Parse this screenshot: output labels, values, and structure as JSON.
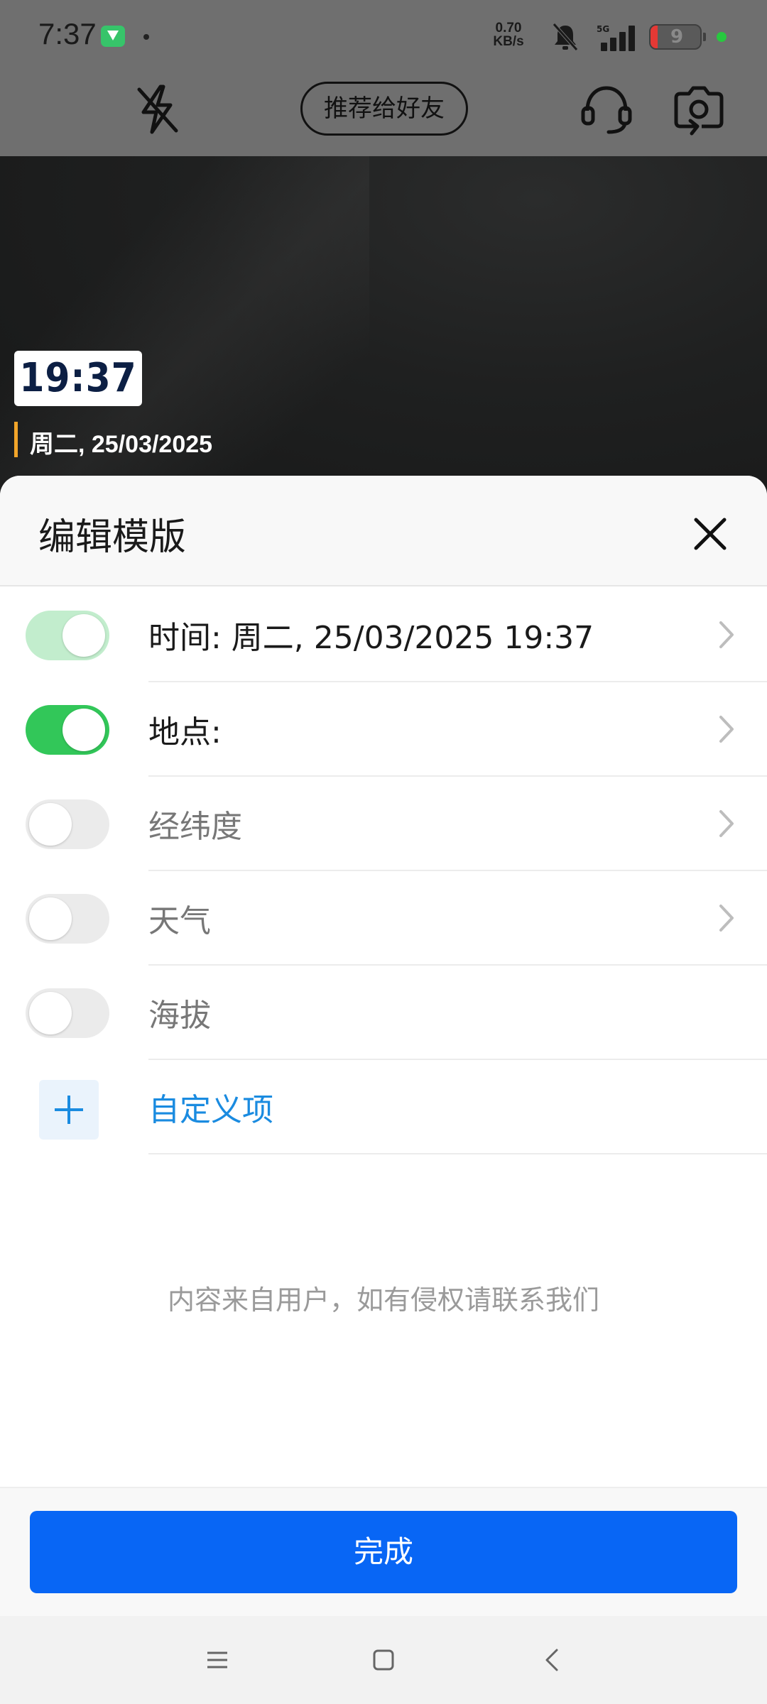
{
  "status_bar": {
    "time": "7:37",
    "net_speed_value": "0.70",
    "net_speed_unit": "KB/s",
    "network_type": "5G",
    "battery_level": "9"
  },
  "camera_toolbar": {
    "recommend_label": "推荐给好友"
  },
  "watermark": {
    "time": "19:37",
    "date": "周二, 25/03/2025"
  },
  "sheet": {
    "title": "编辑模版",
    "items": [
      {
        "label": "时间: 周二, 25/03/2025 19:37",
        "state": "on-locked",
        "has_chevron": true
      },
      {
        "label": "地点:",
        "state": "on",
        "has_chevron": true
      },
      {
        "label": "经纬度",
        "state": "off",
        "has_chevron": true
      },
      {
        "label": "天气",
        "state": "off",
        "has_chevron": true
      },
      {
        "label": "海拔",
        "state": "off",
        "has_chevron": false
      }
    ],
    "custom_item_label": "自定义项",
    "notice": "内容来自用户，如有侵权请联系我们",
    "done_label": "完成"
  },
  "colors": {
    "toggle_on": "#32c759",
    "toggle_locked": "#c2edcd",
    "primary_button": "#0866f5",
    "link_blue": "#1a8be0"
  }
}
